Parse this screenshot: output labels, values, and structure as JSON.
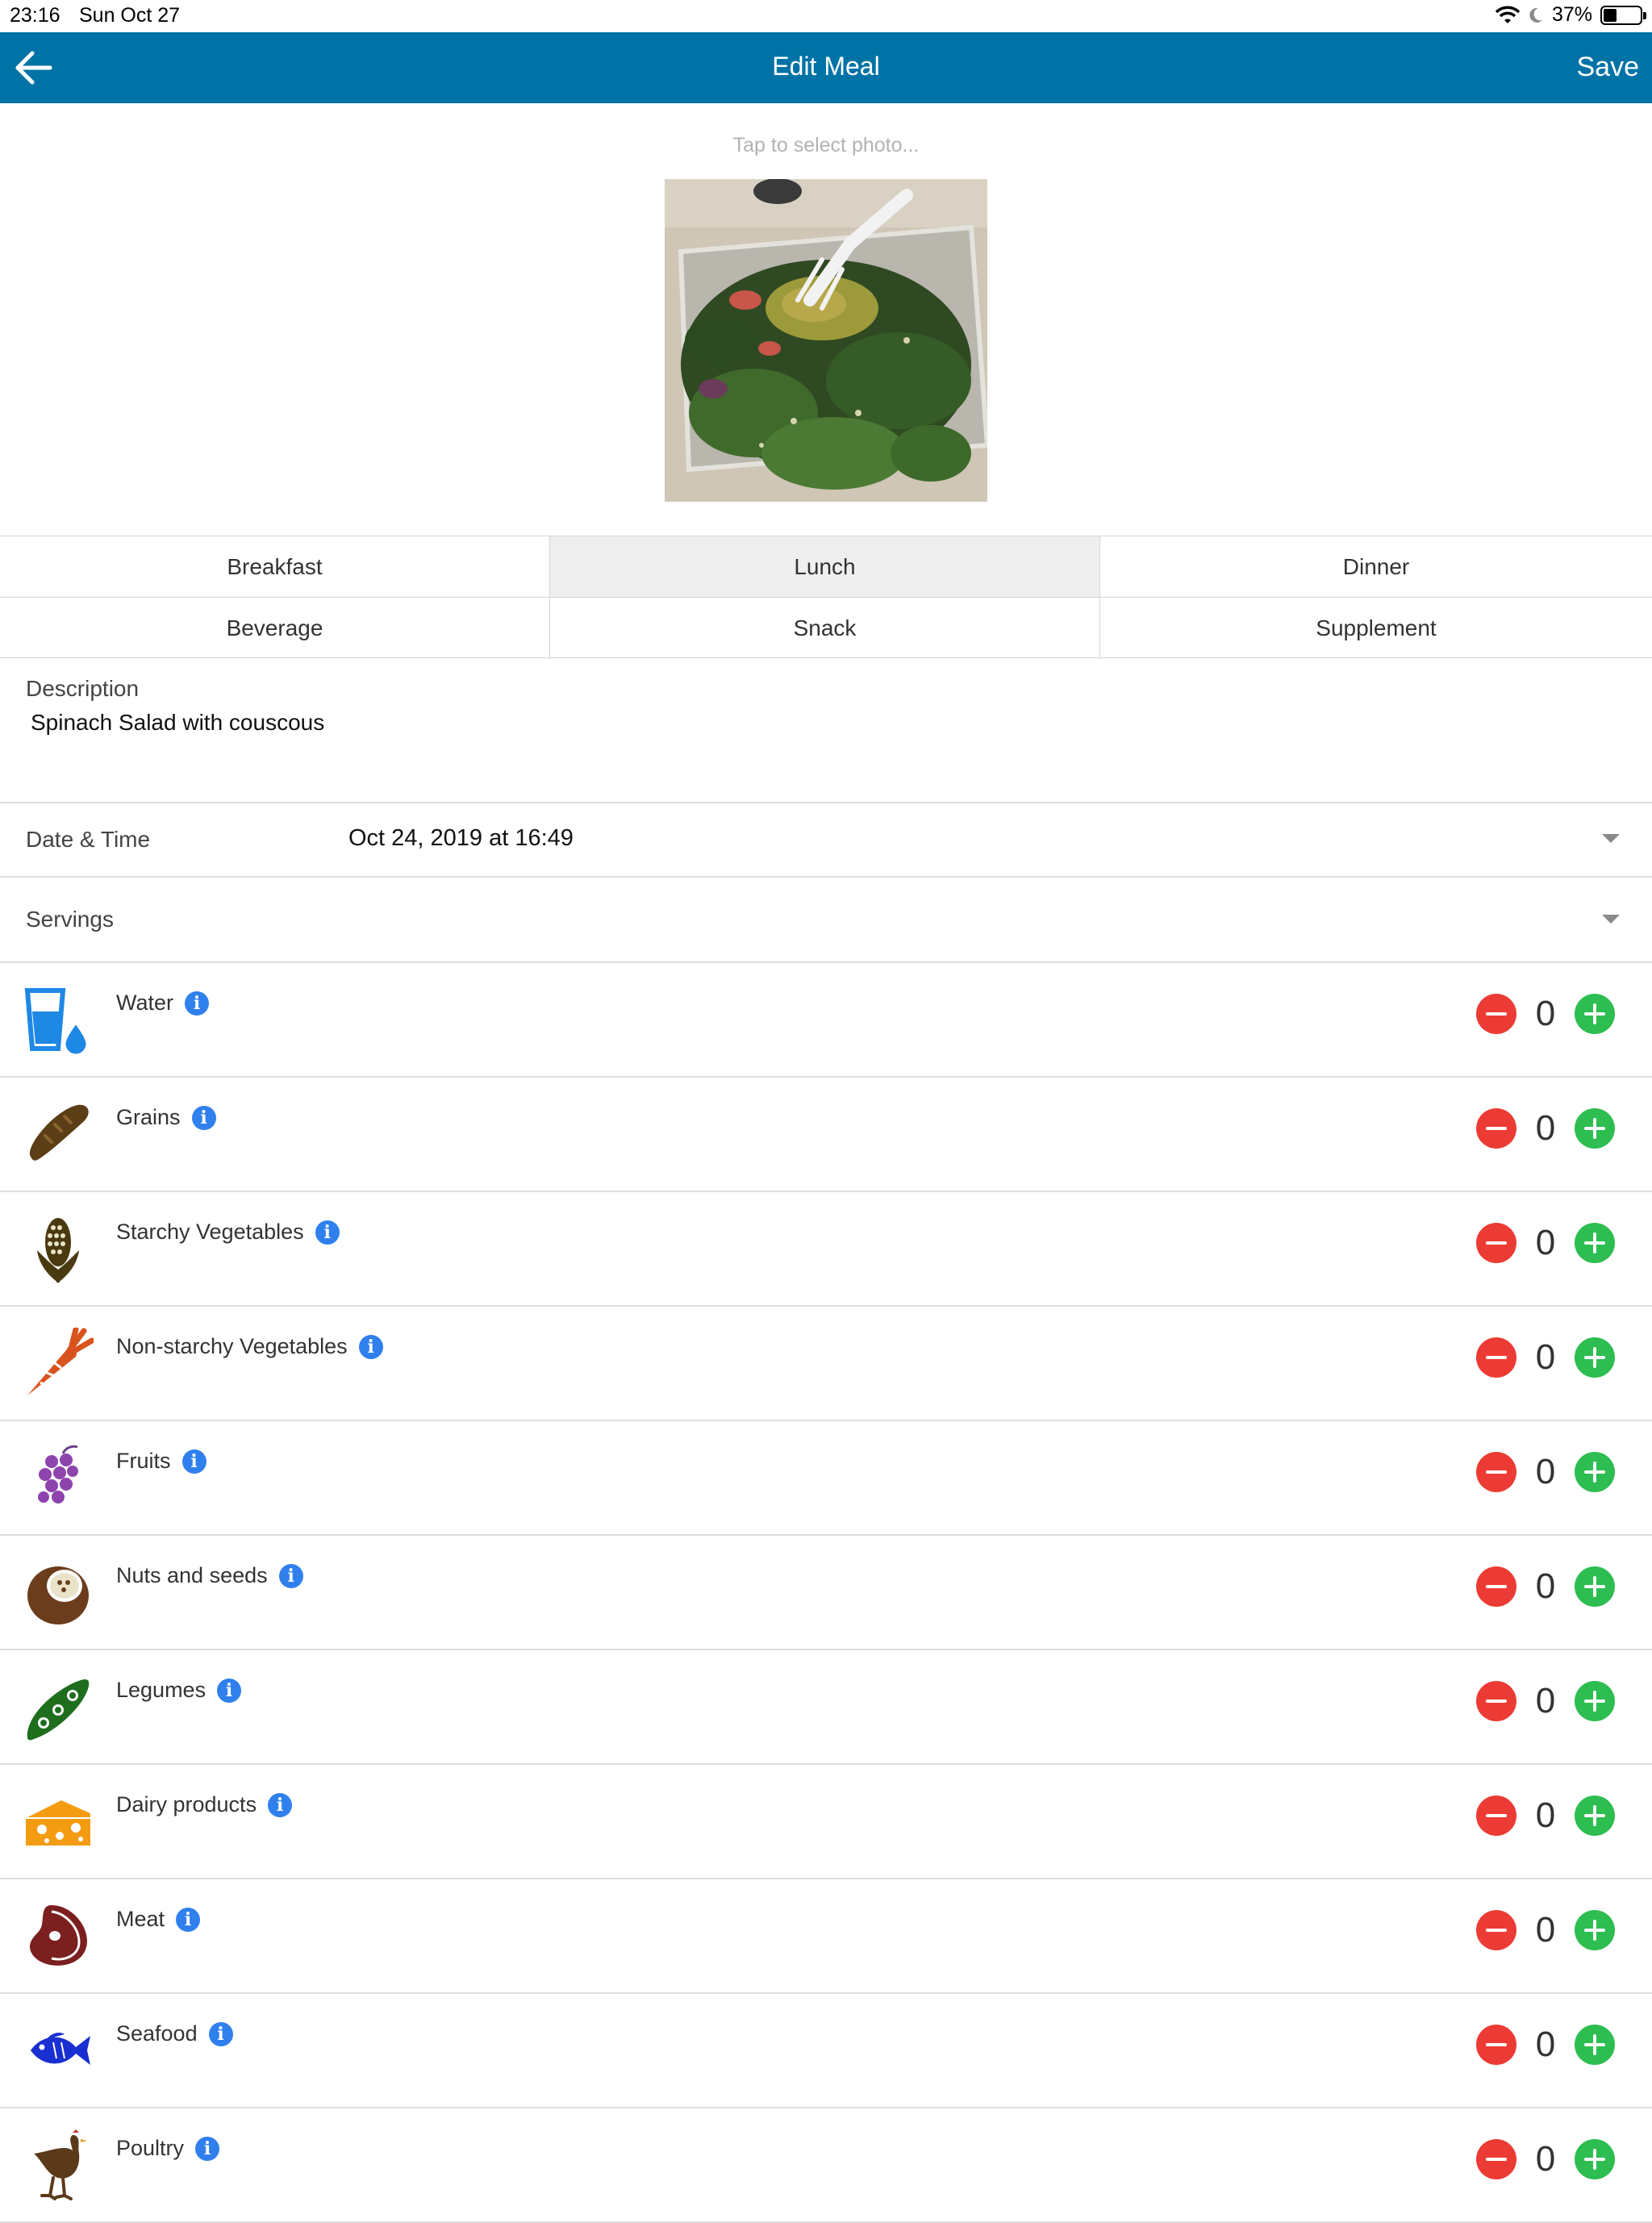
{
  "status": {
    "time": "23:16",
    "date": "Sun Oct 27",
    "battery": "37%",
    "battery_level": 0.37
  },
  "nav": {
    "title": "Edit Meal",
    "save_label": "Save"
  },
  "photo": {
    "hint": "Tap to select photo..."
  },
  "meal_types": [
    {
      "label": "Breakfast",
      "selected": false
    },
    {
      "label": "Lunch",
      "selected": true
    },
    {
      "label": "Dinner",
      "selected": false
    },
    {
      "label": "Beverage",
      "selected": false
    },
    {
      "label": "Snack",
      "selected": false
    },
    {
      "label": "Supplement",
      "selected": false
    }
  ],
  "description": {
    "label": "Description",
    "value": "Spinach Salad with couscous"
  },
  "datetime": {
    "label": "Date & Time",
    "value": "Oct 24, 2019 at 16:49"
  },
  "servings": {
    "label": "Servings",
    "items": [
      {
        "name": "Water",
        "count": "0",
        "icon": "water-glass-icon"
      },
      {
        "name": "Grains",
        "count": "0",
        "icon": "bread-icon"
      },
      {
        "name": "Starchy Vegetables",
        "count": "0",
        "icon": "corn-icon"
      },
      {
        "name": "Non-starchy Vegetables",
        "count": "0",
        "icon": "carrot-icon"
      },
      {
        "name": "Fruits",
        "count": "0",
        "icon": "grapes-icon"
      },
      {
        "name": "Nuts and seeds",
        "count": "0",
        "icon": "coconut-icon"
      },
      {
        "name": "Legumes",
        "count": "0",
        "icon": "pea-pod-icon"
      },
      {
        "name": "Dairy products",
        "count": "0",
        "icon": "cheese-icon"
      },
      {
        "name": "Meat",
        "count": "0",
        "icon": "steak-icon"
      },
      {
        "name": "Seafood",
        "count": "0",
        "icon": "fish-icon"
      },
      {
        "name": "Poultry",
        "count": "0",
        "icon": "chicken-icon"
      }
    ]
  },
  "colors": {
    "nav_bar": "#0073a6",
    "minus": "#ec3b34",
    "plus": "#2dbd50",
    "info": "#2f80ed",
    "selected_meal_bg": "#efefef"
  }
}
